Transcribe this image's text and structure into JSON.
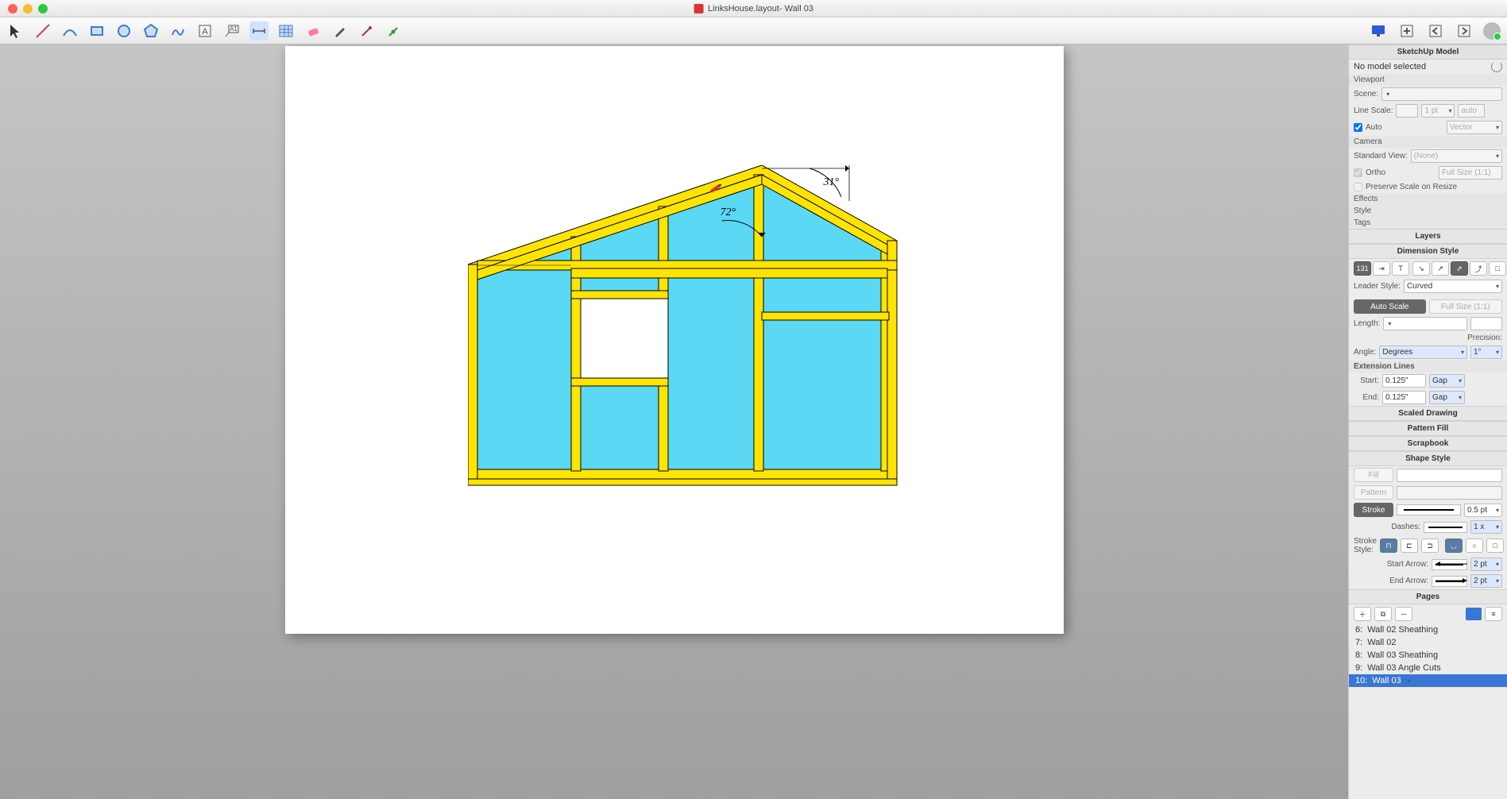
{
  "window": {
    "title": "LinksHouse.layout- Wall 03"
  },
  "inspector": {
    "header_model": "SketchUp Model",
    "no_model": "No model selected",
    "viewport": "Viewport",
    "scene_label": "Scene:",
    "line_scale_label": "Line Scale:",
    "line_scale_val": "1 pt",
    "line_scale_auto": "auto",
    "auto_chk": "Auto",
    "render_mode": "Vector",
    "camera": "Camera",
    "std_view_label": "Standard View:",
    "std_view_val": "(None)",
    "ortho": "Ortho",
    "ortho_scale": "Full Size (1:1)",
    "preserve": "Preserve Scale on Resize",
    "effects": "Effects",
    "style": "Style",
    "tags": "Tags",
    "layers": "Layers",
    "dim_style": "Dimension Style",
    "leader_style_label": "Leader Style:",
    "leader_style_val": "Curved",
    "auto_scale_btn": "Auto Scale",
    "full_size_btn": "Full Size (1:1)",
    "length_label": "Length:",
    "precision_label": "Precision:",
    "angle_label": "Angle:",
    "angle_unit": "Degrees",
    "angle_prec": "1°",
    "ext_lines": "Extension Lines",
    "ext_start": "Start:",
    "ext_end": "End:",
    "ext_val": "0.125\"",
    "ext_gap": "Gap",
    "scaled_drawing": "Scaled Drawing",
    "pattern_fill": "Pattern Fill",
    "scrapbook": "Scrapbook",
    "shape_style": "Shape Style",
    "fill_btn": "Fill",
    "pattern_btn": "Pattern",
    "stroke_btn": "Stroke",
    "stroke_w": "0.5 pt",
    "dashes_label": "Dashes:",
    "dashes_scale": "1 x",
    "stroke_style_label": "Stroke Style:",
    "start_arrow": "Start Arrow:",
    "end_arrow": "End Arrow:",
    "arrow_size": "2 pt",
    "pages": "Pages"
  },
  "pages_list": [
    {
      "num": "6:",
      "name": "Wall 02 Sheathing"
    },
    {
      "num": "7:",
      "name": "Wall 02"
    },
    {
      "num": "8:",
      "name": "Wall 03 Sheathing"
    },
    {
      "num": "9:",
      "name": "Wall 03 Angle Cuts"
    },
    {
      "num": "10:",
      "name": "Wall 03"
    }
  ],
  "drawing": {
    "angle1": "72°",
    "angle2": "31°"
  }
}
